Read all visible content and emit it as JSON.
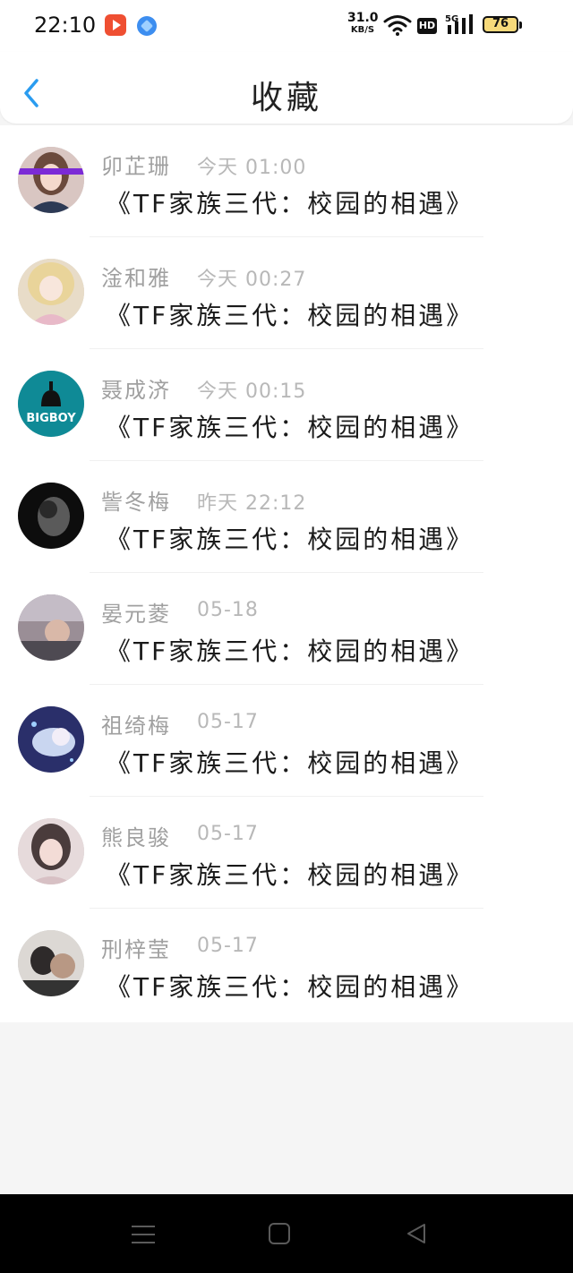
{
  "status_bar": {
    "time": "22:10",
    "net_speed": "31.0",
    "net_unit": "KB/S",
    "hd_label": "HD",
    "signal_label": "5G",
    "battery_level": "76"
  },
  "header": {
    "title": "收藏",
    "back_icon": "chevron-left-icon",
    "accent_color": "#2a9cf0"
  },
  "items": [
    {
      "name": "卯芷珊",
      "time": "今天 01:00",
      "title": "《TF家族三代：校园的相遇》"
    },
    {
      "name": "淦和雅",
      "time": "今天 00:27",
      "title": "《TF家族三代：校园的相遇》"
    },
    {
      "name": "聂成济",
      "time": "今天 00:15",
      "title": "《TF家族三代：校园的相遇》"
    },
    {
      "name": "訾冬梅",
      "time": "昨天 22:12",
      "title": "《TF家族三代：校园的相遇》"
    },
    {
      "name": "晏元菱",
      "time": "05-18",
      "title": "《TF家族三代：校园的相遇》"
    },
    {
      "name": "祖绮梅",
      "time": "05-17",
      "title": "《TF家族三代：校园的相遇》"
    },
    {
      "name": "熊良骏",
      "time": "05-17",
      "title": "《TF家族三代：校园的相遇》"
    },
    {
      "name": "刑梓莹",
      "time": "05-17",
      "title": "《TF家族三代：校园的相遇》"
    }
  ],
  "avatar_3_text": "BIGBOY",
  "nav": {
    "menu_icon": "menu-icon",
    "home_icon": "home-square-icon",
    "back_icon": "back-triangle-icon"
  }
}
